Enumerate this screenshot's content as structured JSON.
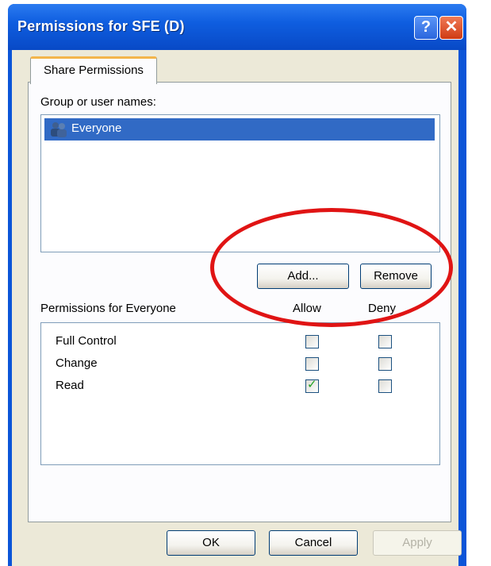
{
  "window": {
    "title": "Permissions for SFE (D)",
    "help_glyph": "?",
    "close_glyph": "✕"
  },
  "tabs": [
    {
      "label": "Share Permissions",
      "active": true
    }
  ],
  "group_section": {
    "label": "Group or user names:",
    "users": [
      {
        "name": "Everyone",
        "selected": true,
        "icon": "group-icon"
      }
    ],
    "add_label": "Add...",
    "remove_label": "Remove"
  },
  "permissions": {
    "header": "Permissions for Everyone",
    "allow_header": "Allow",
    "deny_header": "Deny",
    "rows": [
      {
        "name": "Full Control",
        "allow": false,
        "deny": false
      },
      {
        "name": "Change",
        "allow": false,
        "deny": false
      },
      {
        "name": "Read",
        "allow": true,
        "deny": false
      }
    ]
  },
  "footer": {
    "ok_label": "OK",
    "cancel_label": "Cancel",
    "apply_label": "Apply"
  },
  "colors": {
    "titlebar": "#0b55d8",
    "selection": "#316ac5",
    "annotation": "#e01414",
    "check": "#21a121"
  }
}
